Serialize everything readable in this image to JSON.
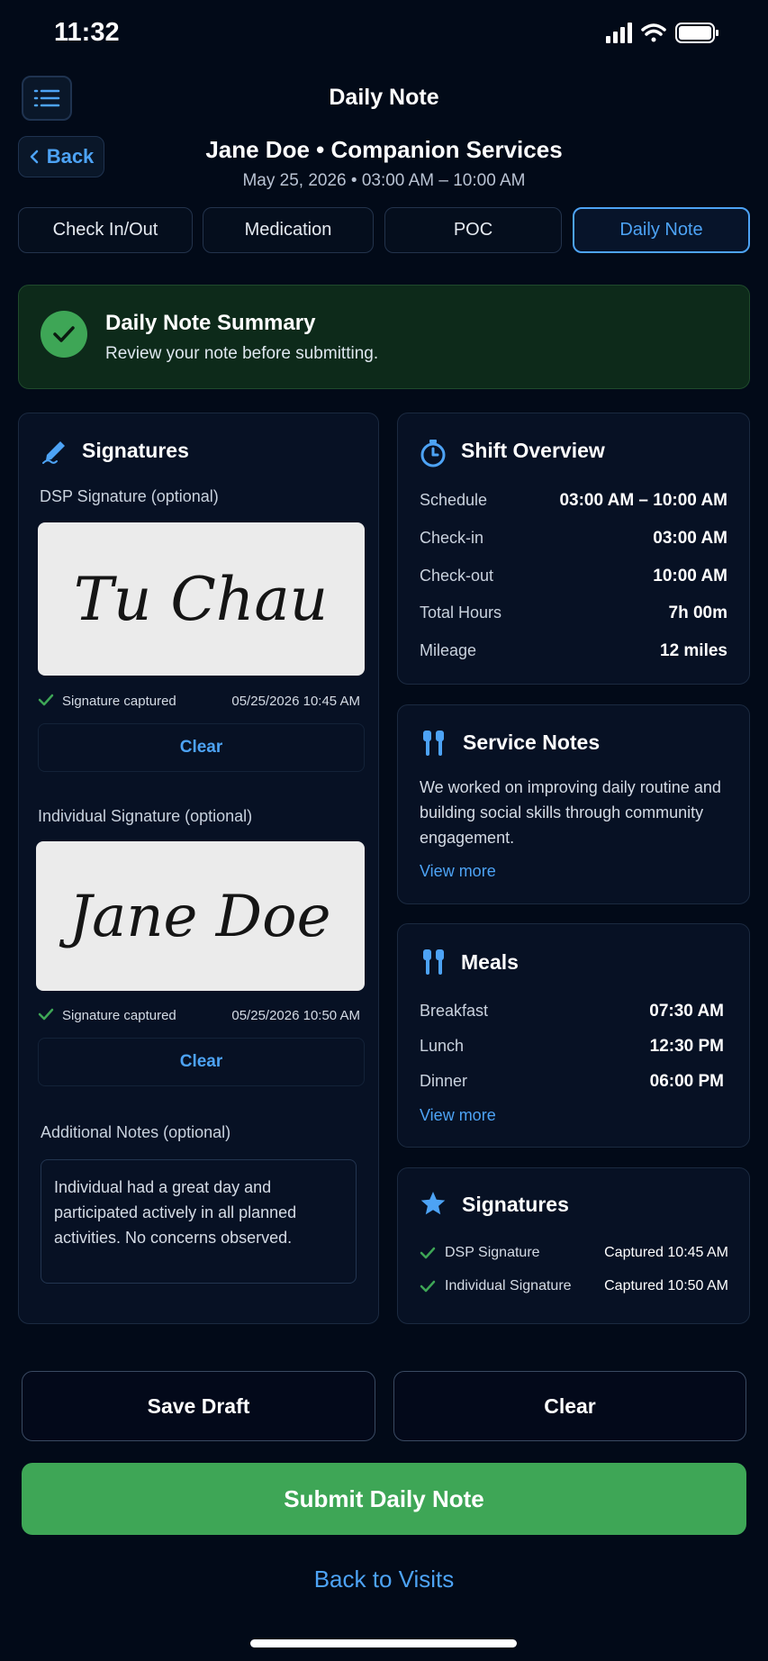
{
  "status_bar": {
    "time": "11:32"
  },
  "header": {
    "title": "Daily Note",
    "back_label": "Back",
    "client_title": "Jane Doe • Companion Services",
    "visit_time": "May 25, 2026 • 03:00 AM – 10:00 AM"
  },
  "tabs": [
    {
      "label": "Check In/Out",
      "active": false
    },
    {
      "label": "Medication",
      "active": false
    },
    {
      "label": "POC",
      "active": false
    },
    {
      "label": "Daily Note",
      "active": true
    }
  ],
  "summary": {
    "title": "Daily Note Summary",
    "subtitle": "Review your note before submitting."
  },
  "signatures_card": {
    "title": "Signatures",
    "dsp": {
      "label": "DSP Signature (optional)",
      "signature_text": "Tu Chau",
      "status": "Signature captured",
      "timestamp": "05/25/2026 10:45 AM",
      "clear_label": "Clear"
    },
    "individual": {
      "label": "Individual Signature (optional)",
      "signature_text": "Jane Doe",
      "status": "Signature captured",
      "timestamp": "05/25/2026 10:50 AM",
      "clear_label": "Clear"
    },
    "notes_label": "Additional Notes (optional)",
    "notes_value": "Individual had a great day and participated actively in all planned activities. No concerns observed."
  },
  "shift_overview": {
    "title": "Shift Overview",
    "rows": [
      {
        "label": "Schedule",
        "value": "03:00 AM – 10:00 AM"
      },
      {
        "label": "Check-in",
        "value": "03:00 AM"
      },
      {
        "label": "Check-out",
        "value": "10:00 AM"
      },
      {
        "label": "Total Hours",
        "value": "7h 00m"
      },
      {
        "label": "Mileage",
        "value": "12 miles"
      }
    ]
  },
  "service_notes": {
    "title": "Service Notes",
    "text": "We worked on improving daily routine and building social skills through community engagement.",
    "view_more": "View more"
  },
  "meals": {
    "title": "Meals",
    "rows": [
      {
        "label": "Breakfast",
        "value": "07:30 AM"
      },
      {
        "label": "Lunch",
        "value": "12:30 PM"
      },
      {
        "label": "Dinner",
        "value": "06:00 PM"
      }
    ],
    "view_more": "View more"
  },
  "signatures_summary": {
    "title": "Signatures",
    "rows": [
      {
        "label": "DSP Signature",
        "value": "Captured 10:45 AM"
      },
      {
        "label": "Individual Signature",
        "value": "Captured 10:50 AM"
      }
    ]
  },
  "actions": {
    "save_draft": "Save Draft",
    "clear": "Clear",
    "submit": "Submit Daily Note",
    "back_to_visits": "Back to Visits"
  },
  "colors": {
    "accent": "#4da3f5",
    "success": "#3ea656",
    "background": "#020a18"
  }
}
